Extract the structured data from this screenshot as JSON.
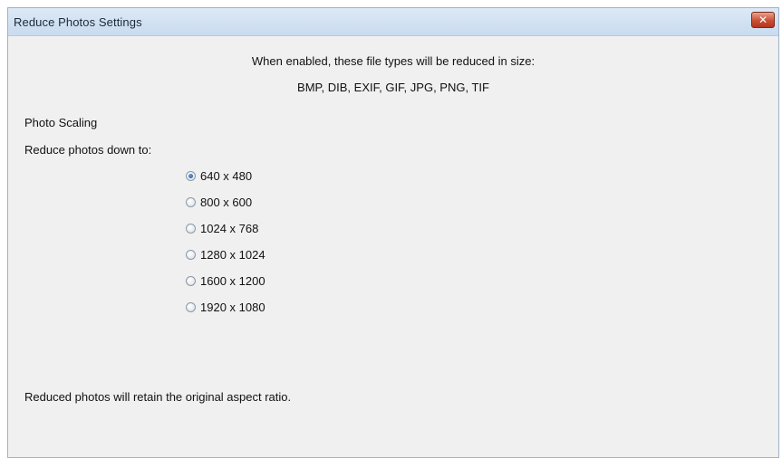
{
  "window": {
    "title": "Reduce Photos Settings",
    "close_label": "✕"
  },
  "info": {
    "line1": "When enabled, these file types will be reduced in size:",
    "line2": "BMP, DIB, EXIF, GIF, JPG, PNG, TIF"
  },
  "photo_scaling": {
    "section_label": "Photo Scaling",
    "reduce_label": "Reduce photos down to:",
    "selected": "640 x 480",
    "options": [
      {
        "label": "640 x 480"
      },
      {
        "label": "800 x 600"
      },
      {
        "label": "1024 x 768"
      },
      {
        "label": "1280 x 1024"
      },
      {
        "label": "1600 x 1200"
      },
      {
        "label": "1920 x 1080"
      }
    ]
  },
  "footer": {
    "note": "Reduced photos will retain the original aspect ratio."
  },
  "colors": {
    "dialog_background": "#f0f0f0",
    "titlebar": "#c9dbef",
    "close_button": "#c94f35"
  },
  "icons": {
    "close": "close-icon"
  }
}
